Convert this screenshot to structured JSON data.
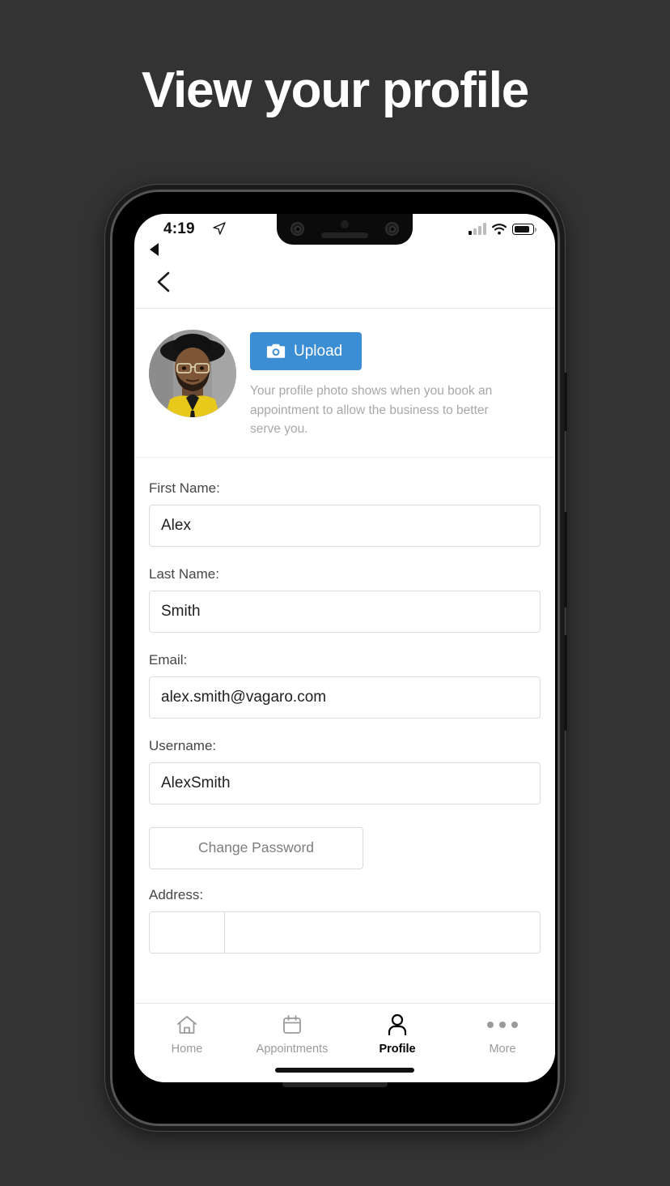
{
  "headline": "View your profile",
  "theme": {
    "background": "#333333",
    "accent_blue": "#3b8dd4",
    "text_dark": "#1f1f1f",
    "text_muted": "#a8a8a8"
  },
  "phone": {
    "status_bar": {
      "time": "4:19",
      "location_icon": "location-arrow-icon",
      "back_to_app_icon": "back-triangle-icon",
      "cellular_icon": "signal-bars-icon",
      "wifi_icon": "wifi-icon",
      "battery_icon": "battery-icon",
      "battery_level": "84"
    },
    "nav": {
      "back_icon": "chevron-left-icon"
    },
    "photo_section": {
      "avatar_alt": "profile-photo",
      "upload_label": "Upload",
      "upload_icon": "camera-icon",
      "note": "Your profile photo shows when you book an appointment to allow the business to better serve you."
    },
    "form": {
      "fields": [
        {
          "label": "First Name:",
          "value": "Alex",
          "name": "first-name"
        },
        {
          "label": "Last Name:",
          "value": "Smith",
          "name": "last-name"
        },
        {
          "label": "Email:",
          "value": "alex.smith@vagaro.com",
          "name": "email"
        },
        {
          "label": "Username:",
          "value": "AlexSmith",
          "name": "username"
        }
      ],
      "change_password_label": "Change Password",
      "address_label": "Address:",
      "address_value": "",
      "address_segment_value": ""
    },
    "tabbar": {
      "tabs": [
        {
          "label": "Home",
          "icon": "home-icon",
          "active": false
        },
        {
          "label": "Appointments",
          "icon": "calendar-icon",
          "active": false
        },
        {
          "label": "Profile",
          "icon": "person-icon",
          "active": true
        },
        {
          "label": "More",
          "icon": "ellipsis-icon",
          "active": false
        }
      ]
    }
  }
}
